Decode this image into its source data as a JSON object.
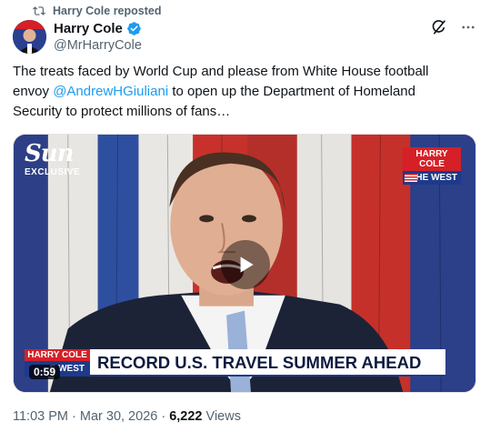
{
  "repost": {
    "label": "Harry Cole reposted"
  },
  "author": {
    "name": "Harry Cole",
    "handle": "@MrHarryCole"
  },
  "tweet": {
    "text_part1": "The treats faced by World Cup and please from White House football envoy ",
    "mention": "@AndrewHGiuliani",
    "text_part2": " to open up the Department of Homeland Security to protect millions of fans…"
  },
  "video": {
    "source_logo": "Sun",
    "source_tag": "EXCLUSIVE",
    "badge_top": "HARRY COLE",
    "badge_bottom": "THE WEST",
    "chyron_brand_top": "HARRY COLE",
    "chyron_brand_bottom": "E WEST",
    "headline": "RECORD U.S. TRAVEL SUMMER AHEAD",
    "duration": "0:59"
  },
  "meta": {
    "timestamp": "11:03 PM · Mar 30, 2026 · ",
    "views_count": "6,222",
    "views_label": " Views"
  },
  "colors": {
    "accent": "#1d9bf0",
    "brand_red": "#d52027",
    "brand_blue": "#1e3a8a"
  }
}
